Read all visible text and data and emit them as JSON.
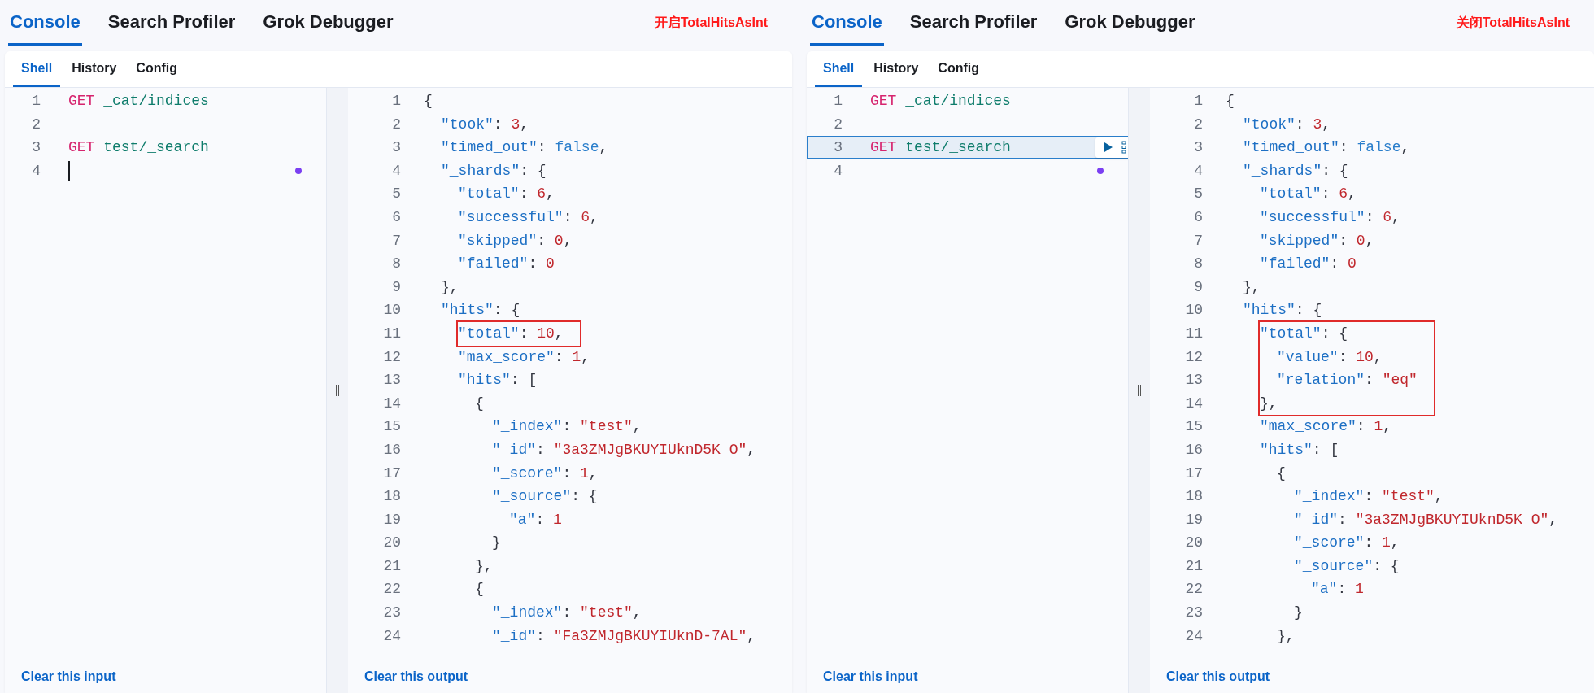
{
  "panels": [
    {
      "tabs": [
        {
          "label": "Console",
          "selected": true
        },
        {
          "label": "Search Profiler",
          "selected": false
        },
        {
          "label": "Grok Debugger",
          "selected": false
        }
      ],
      "note": "开启TotalHitsAsInt",
      "sub_tabs": [
        {
          "label": "Shell",
          "selected": true
        },
        {
          "label": "History",
          "selected": false
        },
        {
          "label": "Config",
          "selected": false
        }
      ],
      "input": {
        "lines": [
          {
            "number": "1",
            "tokens": [
              {
                "kind": "method",
                "text": "GET"
              },
              {
                "kind": "path",
                "text": "_cat/indices"
              }
            ],
            "selected": false,
            "cursor": false
          },
          {
            "number": "2",
            "selected": false
          },
          {
            "number": "3",
            "tokens": [
              {
                "kind": "method",
                "text": "GET"
              },
              {
                "kind": "path",
                "text": "test/_search"
              }
            ],
            "selected": false
          },
          {
            "number": "4",
            "selected": false,
            "cursor": true
          }
        ],
        "clear_link": "Clear this input"
      },
      "output": {
        "lines": [
          {
            "number": "1",
            "boxed": false,
            "tokens": [
              {
                "kind": "punct",
                "text": "{"
              }
            ]
          },
          {
            "number": "2",
            "boxed": false,
            "tokens": [
              {
                "kind": "key",
                "text": "\"took\""
              },
              {
                "kind": "punct",
                "text": ": "
              },
              {
                "kind": "number",
                "text": "3"
              },
              {
                "kind": "punct",
                "text": ","
              }
            ]
          },
          {
            "number": "3",
            "boxed": false,
            "tokens": [
              {
                "kind": "key",
                "text": "\"timed_out\""
              },
              {
                "kind": "punct",
                "text": ": "
              },
              {
                "kind": "boolean",
                "text": "false"
              },
              {
                "kind": "punct",
                "text": ","
              }
            ]
          },
          {
            "number": "4",
            "boxed": false,
            "tokens": [
              {
                "kind": "key",
                "text": "\"_shards\""
              },
              {
                "kind": "punct",
                "text": ": {"
              }
            ]
          },
          {
            "number": "5",
            "boxed": false,
            "tokens": [
              {
                "kind": "key",
                "text": "\"total\""
              },
              {
                "kind": "punct",
                "text": ": "
              },
              {
                "kind": "number",
                "text": "6"
              },
              {
                "kind": "punct",
                "text": ","
              }
            ]
          },
          {
            "number": "6",
            "boxed": false,
            "tokens": [
              {
                "kind": "key",
                "text": "\"successful\""
              },
              {
                "kind": "punct",
                "text": ": "
              },
              {
                "kind": "number",
                "text": "6"
              },
              {
                "kind": "punct",
                "text": ","
              }
            ]
          },
          {
            "number": "7",
            "boxed": false,
            "tokens": [
              {
                "kind": "key",
                "text": "\"skipped\""
              },
              {
                "kind": "punct",
                "text": ": "
              },
              {
                "kind": "number",
                "text": "0"
              },
              {
                "kind": "punct",
                "text": ","
              }
            ]
          },
          {
            "number": "8",
            "boxed": false,
            "tokens": [
              {
                "kind": "key",
                "text": "\"failed\""
              },
              {
                "kind": "punct",
                "text": ": "
              },
              {
                "kind": "number",
                "text": "0"
              }
            ]
          },
          {
            "number": "9",
            "boxed": false,
            "tokens": [
              {
                "kind": "punct",
                "text": "},"
              }
            ]
          },
          {
            "number": "10",
            "boxed": false,
            "tokens": [
              {
                "kind": "key",
                "text": "\"hits\""
              },
              {
                "kind": "punct",
                "text": ": {"
              }
            ]
          },
          {
            "number": "11",
            "boxed": true,
            "tokens": [
              {
                "kind": "key",
                "text": "\"total\""
              },
              {
                "kind": "punct",
                "text": ": "
              },
              {
                "kind": "number",
                "text": "10"
              },
              {
                "kind": "punct",
                "text": ","
              }
            ]
          },
          {
            "number": "12",
            "boxed": false,
            "tokens": [
              {
                "kind": "key",
                "text": "\"max_score\""
              },
              {
                "kind": "punct",
                "text": ": "
              },
              {
                "kind": "number",
                "text": "1"
              },
              {
                "kind": "punct",
                "text": ","
              }
            ]
          },
          {
            "number": "13",
            "boxed": false,
            "tokens": [
              {
                "kind": "key",
                "text": "\"hits\""
              },
              {
                "kind": "punct",
                "text": ": ["
              }
            ]
          },
          {
            "number": "14",
            "boxed": false,
            "tokens": [
              {
                "kind": "punct",
                "text": "{"
              }
            ]
          },
          {
            "number": "15",
            "boxed": false,
            "tokens": [
              {
                "kind": "key",
                "text": "\"_index\""
              },
              {
                "kind": "punct",
                "text": ": "
              },
              {
                "kind": "string",
                "text": "\"test\""
              },
              {
                "kind": "punct",
                "text": ","
              }
            ]
          },
          {
            "number": "16",
            "boxed": false,
            "tokens": [
              {
                "kind": "key",
                "text": "\"_id\""
              },
              {
                "kind": "punct",
                "text": ": "
              },
              {
                "kind": "string",
                "text": "\"3a3ZMJgBKUYIUknD5K_O\""
              },
              {
                "kind": "punct",
                "text": ","
              }
            ]
          },
          {
            "number": "17",
            "boxed": false,
            "tokens": [
              {
                "kind": "key",
                "text": "\"_score\""
              },
              {
                "kind": "punct",
                "text": ": "
              },
              {
                "kind": "number",
                "text": "1"
              },
              {
                "kind": "punct",
                "text": ","
              }
            ]
          },
          {
            "number": "18",
            "boxed": false,
            "tokens": [
              {
                "kind": "key",
                "text": "\"_source\""
              },
              {
                "kind": "punct",
                "text": ": {"
              }
            ]
          },
          {
            "number": "19",
            "boxed": false,
            "tokens": [
              {
                "kind": "key",
                "text": "\"a\""
              },
              {
                "kind": "punct",
                "text": ": "
              },
              {
                "kind": "number",
                "text": "1"
              }
            ]
          },
          {
            "number": "20",
            "boxed": false,
            "tokens": [
              {
                "kind": "punct",
                "text": "}"
              }
            ]
          },
          {
            "number": "21",
            "boxed": false,
            "tokens": [
              {
                "kind": "punct",
                "text": "},"
              }
            ]
          },
          {
            "number": "22",
            "boxed": false,
            "tokens": [
              {
                "kind": "punct",
                "text": "{"
              }
            ]
          },
          {
            "number": "23",
            "boxed": false,
            "tokens": [
              {
                "kind": "key",
                "text": "\"_index\""
              },
              {
                "kind": "punct",
                "text": ": "
              },
              {
                "kind": "string",
                "text": "\"test\""
              },
              {
                "kind": "punct",
                "text": ","
              }
            ]
          },
          {
            "number": "24",
            "boxed": false,
            "tokens": [
              {
                "kind": "key",
                "text": "\"_id\""
              },
              {
                "kind": "punct",
                "text": ": "
              },
              {
                "kind": "string",
                "text": "\"Fa3ZMJgBKUYIUknD-7AL\""
              },
              {
                "kind": "punct",
                "text": ","
              }
            ]
          }
        ],
        "clear_link": "Clear this output"
      }
    },
    {
      "tabs": [
        {
          "label": "Console",
          "selected": true
        },
        {
          "label": "Search Profiler",
          "selected": false
        },
        {
          "label": "Grok Debugger",
          "selected": false
        }
      ],
      "note": "关闭TotalHitsAsInt",
      "sub_tabs": [
        {
          "label": "Shell",
          "selected": true
        },
        {
          "label": "History",
          "selected": false
        },
        {
          "label": "Config",
          "selected": false
        }
      ],
      "input": {
        "lines": [
          {
            "number": "1",
            "tokens": [
              {
                "kind": "method",
                "text": "GET"
              },
              {
                "kind": "path",
                "text": "_cat/indices"
              }
            ],
            "selected": false,
            "cursor": false
          },
          {
            "number": "2",
            "selected": false
          },
          {
            "number": "3",
            "tokens": [
              {
                "kind": "method",
                "text": "GET"
              },
              {
                "kind": "path",
                "text": "test/_search"
              }
            ],
            "selected": true
          },
          {
            "number": "4",
            "selected": false
          }
        ],
        "clear_link": "Clear this input"
      },
      "output": {
        "lines": [
          {
            "number": "1",
            "boxed": false,
            "tokens": [
              {
                "kind": "punct",
                "text": "{"
              }
            ]
          },
          {
            "number": "2",
            "boxed": false,
            "tokens": [
              {
                "kind": "key",
                "text": "\"took\""
              },
              {
                "kind": "punct",
                "text": ": "
              },
              {
                "kind": "number",
                "text": "3"
              },
              {
                "kind": "punct",
                "text": ","
              }
            ]
          },
          {
            "number": "3",
            "boxed": false,
            "tokens": [
              {
                "kind": "key",
                "text": "\"timed_out\""
              },
              {
                "kind": "punct",
                "text": ": "
              },
              {
                "kind": "boolean",
                "text": "false"
              },
              {
                "kind": "punct",
                "text": ","
              }
            ]
          },
          {
            "number": "4",
            "boxed": false,
            "tokens": [
              {
                "kind": "key",
                "text": "\"_shards\""
              },
              {
                "kind": "punct",
                "text": ": {"
              }
            ]
          },
          {
            "number": "5",
            "boxed": false,
            "tokens": [
              {
                "kind": "key",
                "text": "\"total\""
              },
              {
                "kind": "punct",
                "text": ": "
              },
              {
                "kind": "number",
                "text": "6"
              },
              {
                "kind": "punct",
                "text": ","
              }
            ]
          },
          {
            "number": "6",
            "boxed": false,
            "tokens": [
              {
                "kind": "key",
                "text": "\"successful\""
              },
              {
                "kind": "punct",
                "text": ": "
              },
              {
                "kind": "number",
                "text": "6"
              },
              {
                "kind": "punct",
                "text": ","
              }
            ]
          },
          {
            "number": "7",
            "boxed": false,
            "tokens": [
              {
                "kind": "key",
                "text": "\"skipped\""
              },
              {
                "kind": "punct",
                "text": ": "
              },
              {
                "kind": "number",
                "text": "0"
              },
              {
                "kind": "punct",
                "text": ","
              }
            ]
          },
          {
            "number": "8",
            "boxed": false,
            "tokens": [
              {
                "kind": "key",
                "text": "\"failed\""
              },
              {
                "kind": "punct",
                "text": ": "
              },
              {
                "kind": "number",
                "text": "0"
              }
            ]
          },
          {
            "number": "9",
            "boxed": false,
            "tokens": [
              {
                "kind": "punct",
                "text": "},"
              }
            ]
          },
          {
            "number": "10",
            "boxed": false,
            "tokens": [
              {
                "kind": "key",
                "text": "\"hits\""
              },
              {
                "kind": "punct",
                "text": ": {"
              }
            ]
          },
          {
            "number": "11",
            "boxed": true,
            "tokens": [
              {
                "kind": "key",
                "text": "\"total\""
              },
              {
                "kind": "punct",
                "text": ": {"
              }
            ]
          },
          {
            "number": "12",
            "boxed": true,
            "tokens": [
              {
                "kind": "key",
                "text": "\"value\""
              },
              {
                "kind": "punct",
                "text": ": "
              },
              {
                "kind": "number",
                "text": "10"
              },
              {
                "kind": "punct",
                "text": ","
              }
            ]
          },
          {
            "number": "13",
            "boxed": true,
            "tokens": [
              {
                "kind": "key",
                "text": "\"relation\""
              },
              {
                "kind": "punct",
                "text": ": "
              },
              {
                "kind": "string",
                "text": "\"eq\""
              }
            ]
          },
          {
            "number": "14",
            "boxed": true,
            "tokens": [
              {
                "kind": "punct",
                "text": "},"
              }
            ]
          },
          {
            "number": "15",
            "boxed": false,
            "tokens": [
              {
                "kind": "key",
                "text": "\"max_score\""
              },
              {
                "kind": "punct",
                "text": ": "
              },
              {
                "kind": "number",
                "text": "1"
              },
              {
                "kind": "punct",
                "text": ","
              }
            ]
          },
          {
            "number": "16",
            "boxed": false,
            "tokens": [
              {
                "kind": "key",
                "text": "\"hits\""
              },
              {
                "kind": "punct",
                "text": ": ["
              }
            ]
          },
          {
            "number": "17",
            "boxed": false,
            "tokens": [
              {
                "kind": "punct",
                "text": "{"
              }
            ]
          },
          {
            "number": "18",
            "boxed": false,
            "tokens": [
              {
                "kind": "key",
                "text": "\"_index\""
              },
              {
                "kind": "punct",
                "text": ": "
              },
              {
                "kind": "string",
                "text": "\"test\""
              },
              {
                "kind": "punct",
                "text": ","
              }
            ]
          },
          {
            "number": "19",
            "boxed": false,
            "tokens": [
              {
                "kind": "key",
                "text": "\"_id\""
              },
              {
                "kind": "punct",
                "text": ": "
              },
              {
                "kind": "string",
                "text": "\"3a3ZMJgBKUYIUknD5K_O\""
              },
              {
                "kind": "punct",
                "text": ","
              }
            ]
          },
          {
            "number": "20",
            "boxed": false,
            "tokens": [
              {
                "kind": "key",
                "text": "\"_score\""
              },
              {
                "kind": "punct",
                "text": ": "
              },
              {
                "kind": "number",
                "text": "1"
              },
              {
                "kind": "punct",
                "text": ","
              }
            ]
          },
          {
            "number": "21",
            "boxed": false,
            "tokens": [
              {
                "kind": "key",
                "text": "\"_source\""
              },
              {
                "kind": "punct",
                "text": ": {"
              }
            ]
          },
          {
            "number": "22",
            "boxed": false,
            "tokens": [
              {
                "kind": "key",
                "text": "\"a\""
              },
              {
                "kind": "punct",
                "text": ": "
              },
              {
                "kind": "number",
                "text": "1"
              }
            ]
          },
          {
            "number": "23",
            "boxed": false,
            "tokens": [
              {
                "kind": "punct",
                "text": "}"
              }
            ]
          },
          {
            "number": "24",
            "boxed": false,
            "tokens": [
              {
                "kind": "punct",
                "text": "},"
              }
            ]
          }
        ],
        "clear_link": "Clear this output"
      }
    }
  ]
}
